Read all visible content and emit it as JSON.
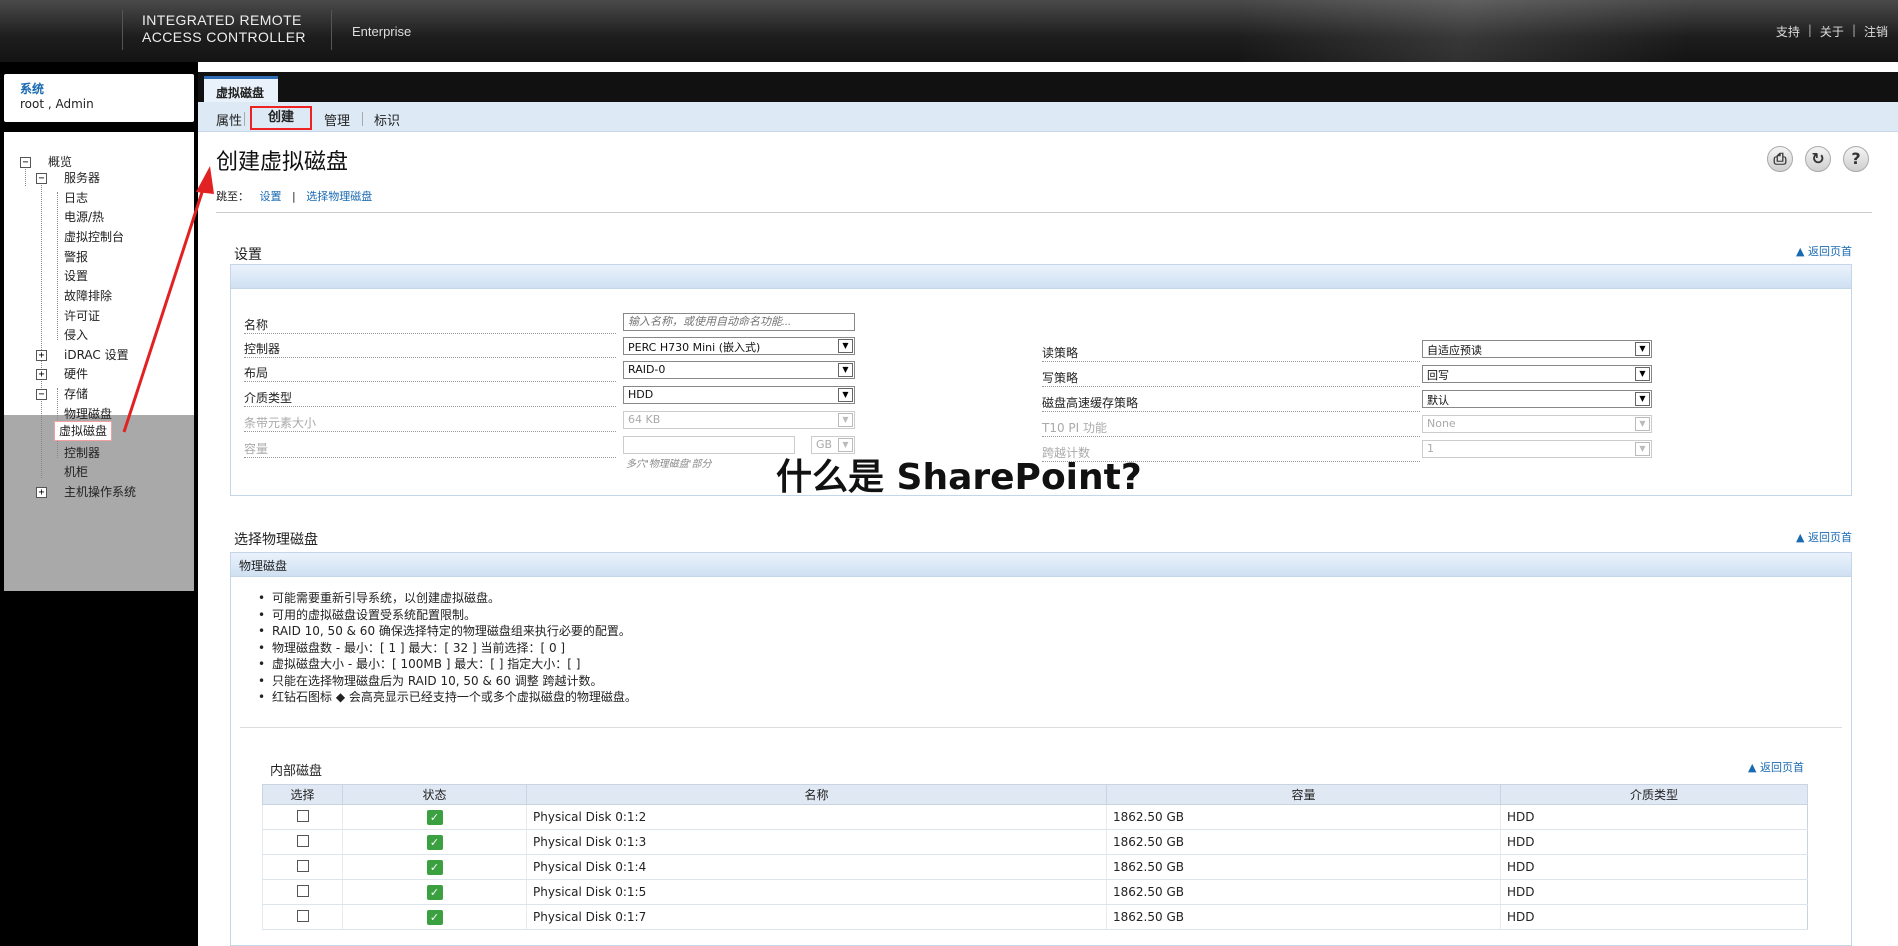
{
  "header": {
    "product_name": "INTEGRATED REMOTE\nACCESS CONTROLLER",
    "edition": "Enterprise",
    "links": [
      "支持",
      "关于",
      "注销"
    ],
    "link_separator": "|"
  },
  "sidebar": {
    "system_title": "系统",
    "user": "root , Admin",
    "tree": {
      "overview": "概览",
      "server": "服务器",
      "log": "日志",
      "power_thermal": "电源/热",
      "virtual_console": "虚拟控制台",
      "alerts": "警报",
      "settings": "设置",
      "troubleshooting": "故障排除",
      "licenses": "许可证",
      "intrusion": "侵入",
      "idrac_settings": "iDRAC 设置",
      "hardware": "硬件",
      "storage": "存储",
      "physical_disks": "物理磁盘",
      "virtual_disks": "虚拟磁盘",
      "controllers": "控制器",
      "enclosures": "机柜",
      "host_os": "主机操作系统"
    }
  },
  "tabs": {
    "main_tab": "虚拟磁盘",
    "subtabs": [
      "属性",
      "创建",
      "管理",
      "标识"
    ]
  },
  "page": {
    "title": "创建虚拟磁盘",
    "jump_to_label": "跳至：",
    "jump_links": [
      "设置",
      "选择物理磁盘"
    ],
    "jump_sep": "|",
    "back_to_top": "返回页首",
    "icons": [
      "print-icon",
      "refresh-icon",
      "help-icon"
    ]
  },
  "settings_section": {
    "title": "设置",
    "fields_left": [
      {
        "label": "名称",
        "type": "input",
        "placeholder": "输入名称，或使用自动命名功能...",
        "disabled": false
      },
      {
        "label": "控制器",
        "type": "select",
        "value": "PERC H730 Mini (嵌入式)",
        "disabled": false
      },
      {
        "label": "布局",
        "type": "select",
        "value": "RAID-0",
        "disabled": false
      },
      {
        "label": "介质类型",
        "type": "select",
        "value": "HDD",
        "disabled": false
      },
      {
        "label": "条带元素大小",
        "type": "select",
        "value": "64 KB",
        "disabled": true
      },
      {
        "label": "容量",
        "type": "input-unit",
        "value": "",
        "unit": "GB",
        "disabled": true,
        "hint": "多穴'物理磁盘'部分"
      }
    ],
    "fields_right": [
      {
        "label": "读策略",
        "value": "自适应预读",
        "disabled": false
      },
      {
        "label": "写策略",
        "value": "回写",
        "disabled": false
      },
      {
        "label": "磁盘高速缓存策略",
        "value": "默认",
        "disabled": false
      },
      {
        "label": "T10 PI 功能",
        "value": "None",
        "disabled": true
      },
      {
        "label": "跨越计数",
        "value": "1",
        "disabled": true
      }
    ]
  },
  "overlay_caption": "什么是 SharePoint?",
  "physical_section": {
    "title": "选择物理磁盘",
    "panel_header": "物理磁盘",
    "notes": [
      "可能需要重新引导系统，以创建虚拟磁盘。",
      "可用的虚拟磁盘设置受系统配置限制。",
      "RAID 10, 50 & 60 确保选择特定的物理磁盘组来执行必要的配置。",
      "物理磁盘数 - 最小：[ 1 ] 最大：[ 32 ] 当前选择：[ 0 ]",
      "虚拟磁盘大小 - 最小：[ 100MB ] 最大：[ ] 指定大小：[ ]",
      "只能在选择物理磁盘后为 RAID 10, 50 & 60 调整 跨越计数。",
      "红钻石图标 ◆ 会高亮显示已经支持一个或多个虚拟磁盘的物理磁盘。"
    ],
    "internal_title": "内部磁盘",
    "columns": [
      "选择",
      "状态",
      "名称",
      "容量",
      "介质类型"
    ],
    "rows": [
      {
        "name": "Physical Disk 0:1:2",
        "capacity": "1862.50 GB",
        "media": "HDD"
      },
      {
        "name": "Physical Disk 0:1:3",
        "capacity": "1862.50 GB",
        "media": "HDD"
      },
      {
        "name": "Physical Disk 0:1:4",
        "capacity": "1862.50 GB",
        "media": "HDD"
      },
      {
        "name": "Physical Disk 0:1:5",
        "capacity": "1862.50 GB",
        "media": "HDD"
      },
      {
        "name": "Physical Disk 0:1:7",
        "capacity": "1862.50 GB",
        "media": "HDD"
      }
    ]
  },
  "colors": {
    "accent_blue": "#1a6ab3",
    "highlight_red": "#e22222",
    "status_ok": "#3aa040"
  }
}
